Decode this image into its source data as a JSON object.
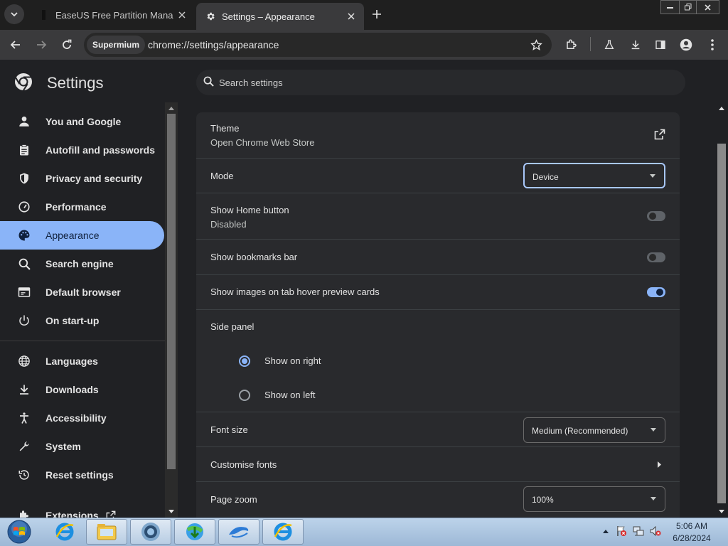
{
  "tabs": [
    {
      "title": "EaseUS Free Partition Manager",
      "active": false
    },
    {
      "title": "Settings – Appearance",
      "active": true
    }
  ],
  "omnibox": {
    "chip": "Supermium",
    "url": "chrome://settings/appearance"
  },
  "settings": {
    "title": "Settings",
    "search_placeholder": "Search settings"
  },
  "sidebar": {
    "items": [
      {
        "label": "You and Google",
        "icon": "person-icon"
      },
      {
        "label": "Autofill and passwords",
        "icon": "clipboard-icon"
      },
      {
        "label": "Privacy and security",
        "icon": "shield-icon"
      },
      {
        "label": "Performance",
        "icon": "gauge-icon"
      },
      {
        "label": "Appearance",
        "icon": "palette-icon",
        "active": true
      },
      {
        "label": "Search engine",
        "icon": "search-icon"
      },
      {
        "label": "Default browser",
        "icon": "browser-icon"
      },
      {
        "label": "On start-up",
        "icon": "power-icon"
      },
      {
        "label": "Languages",
        "icon": "globe-icon"
      },
      {
        "label": "Downloads",
        "icon": "download-icon"
      },
      {
        "label": "Accessibility",
        "icon": "accessibility-icon"
      },
      {
        "label": "System",
        "icon": "wrench-icon"
      },
      {
        "label": "Reset settings",
        "icon": "history-icon"
      },
      {
        "label": "Extensions",
        "icon": "puzzle-icon"
      }
    ]
  },
  "appearance": {
    "theme": {
      "label": "Theme",
      "sub": "Open Chrome Web Store"
    },
    "mode": {
      "label": "Mode",
      "value": "Device"
    },
    "home_button": {
      "label": "Show Home button",
      "sub": "Disabled",
      "enabled": false
    },
    "bookmarks_bar": {
      "label": "Show bookmarks bar",
      "enabled": false
    },
    "tab_hover": {
      "label": "Show images on tab hover preview cards",
      "enabled": true
    },
    "side_panel": {
      "label": "Side panel",
      "options": [
        "Show on right",
        "Show on left"
      ],
      "selected": "Show on right"
    },
    "font_size": {
      "label": "Font size",
      "value": "Medium (Recommended)"
    },
    "customise_fonts": {
      "label": "Customise fonts"
    },
    "page_zoom": {
      "label": "Page zoom",
      "value": "100%"
    }
  },
  "clock": {
    "time": "5:06 AM",
    "date": "6/28/2024"
  },
  "colors": {
    "accent": "#8ab4f8",
    "background": "#202124",
    "card": "#292a2d"
  }
}
